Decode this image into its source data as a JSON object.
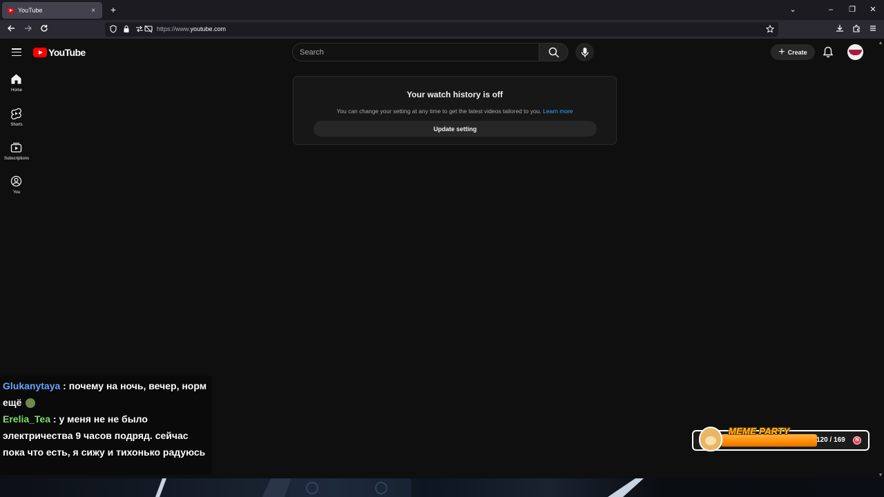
{
  "browser": {
    "tab_title": "YouTube",
    "tab_close": "×",
    "new_tab": "+",
    "url_prefix": "https://www.",
    "url_domain": "youtube.com",
    "window_controls": [
      "⌄",
      "–",
      "❐",
      "✕"
    ]
  },
  "header": {
    "logo_text": "YouTube",
    "search_placeholder": "Search",
    "create_label": "Create"
  },
  "sidebar": {
    "items": [
      {
        "label": "Home",
        "icon": "home-icon"
      },
      {
        "label": "Shorts",
        "icon": "shorts-icon"
      },
      {
        "label": "Subscriptions",
        "icon": "subscriptions-icon"
      },
      {
        "label": "You",
        "icon": "you-icon"
      }
    ]
  },
  "card": {
    "title": "Your watch history is off",
    "text": "You can change your setting at any time to get the latest videos tailored to you.",
    "link": "Learn more",
    "button": "Update setting"
  },
  "chat": {
    "messages": [
      {
        "user": "Glukanytaya",
        "text": " : почему на ночь, вечер, норм ещё"
      },
      {
        "user": "Erelia_Tea",
        "text": " : у меня не не было электричества 9 часов подряд. сейчас пока что есть, я сижу и тихонько радуюсь"
      }
    ]
  },
  "meme_party": {
    "title": "MEME PARTY",
    "count": "120 / 169",
    "progress": 0.71
  },
  "colors": {
    "background": "#0f0f0f",
    "youtube_red": "#ff0000",
    "link_blue": "#3ea6ff",
    "meme_orange": "#ff8c00"
  }
}
